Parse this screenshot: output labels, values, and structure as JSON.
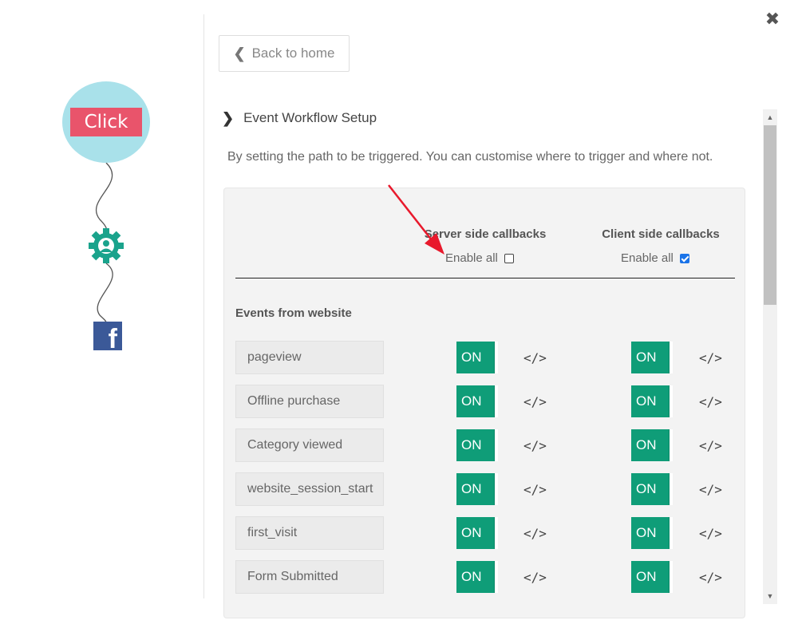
{
  "window": {
    "close_glyph": "✖"
  },
  "flow": {
    "click_node_label": "Click",
    "gear_icon": "gear-icon",
    "facebook_icon": "facebook-icon",
    "facebook_glyph": "f"
  },
  "nav": {
    "back_label": "Back to home"
  },
  "section": {
    "title": "Event Workflow Setup",
    "description": "By setting the path to be triggered. You can customise where to trigger and where not."
  },
  "table": {
    "server_header": "Server side callbacks",
    "client_header": "Client side callbacks",
    "server_enable_label": "Enable all",
    "client_enable_label": "Enable all",
    "server_enable_checked": false,
    "client_enable_checked": true,
    "group_title": "Events from website",
    "events": [
      {
        "name": "pageview",
        "server_toggle": "ON",
        "client_toggle": "ON",
        "code_glyph": "</>"
      },
      {
        "name": "Offline purchase",
        "server_toggle": "ON",
        "client_toggle": "ON",
        "code_glyph": "</>"
      },
      {
        "name": "Category viewed",
        "server_toggle": "ON",
        "client_toggle": "ON",
        "code_glyph": "</>"
      },
      {
        "name": "website_session_start",
        "server_toggle": "ON",
        "client_toggle": "ON",
        "code_glyph": "</>"
      },
      {
        "name": "first_visit",
        "server_toggle": "ON",
        "client_toggle": "ON",
        "code_glyph": "</>"
      },
      {
        "name": "Form Submitted",
        "server_toggle": "ON",
        "client_toggle": "ON",
        "code_glyph": "</>"
      }
    ]
  },
  "colors": {
    "toggle_on": "#0f9d78",
    "click_node_bg": "#a9e1ea",
    "click_label_bg": "#e9546b",
    "gear": "#1aa38c",
    "facebook": "#3b5998",
    "annotation_arrow": "#e8192c"
  }
}
